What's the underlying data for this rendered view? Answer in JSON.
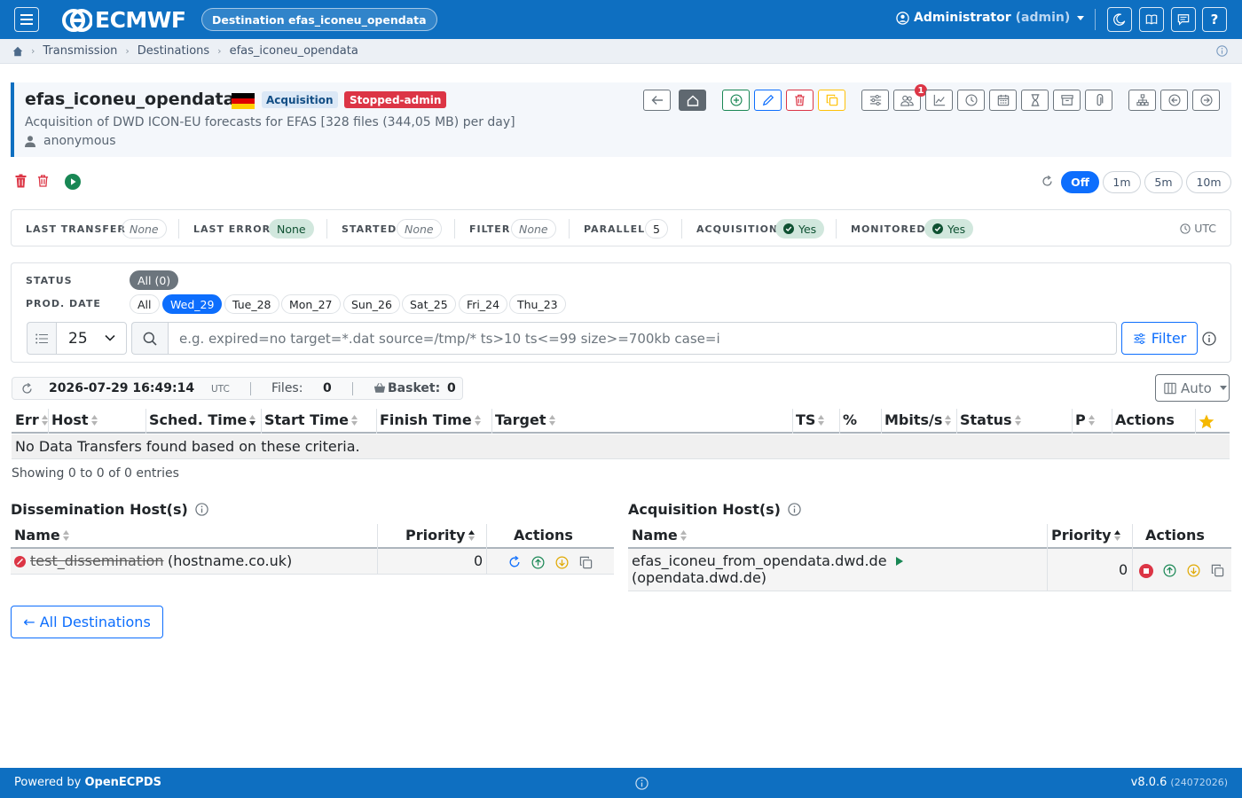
{
  "topbar": {
    "brand": "ECMWF",
    "destination_pill": "Destination efas_iconeu_opendata",
    "user_name": "Administrator",
    "user_role": "(admin)",
    "icons": [
      "menu-icon",
      "moon-icon",
      "book-icon",
      "chat-icon",
      "help-icon"
    ],
    "help_glyph": "?"
  },
  "breadcrumb": {
    "items": [
      "Transmission",
      "Destinations",
      "efas_iconeu_opendata"
    ]
  },
  "destination": {
    "name": "efas_iconeu_opendata",
    "type_badge": "Acquisition",
    "status_badge": "Stopped-admin",
    "description": "Acquisition of DWD ICON-EU forecasts for EFAS [328 files (344,05 MB) per day]",
    "owner": "anonymous",
    "flag_colors": [
      "#000000",
      "#dd0000",
      "#ffce00"
    ],
    "notification_count": "1"
  },
  "refresh": {
    "options": [
      "Off",
      "1m",
      "5m",
      "10m"
    ],
    "selected": "Off"
  },
  "info": {
    "last_transfer_label": "LAST TRANSFER",
    "last_transfer_value": "None",
    "last_error_label": "LAST ERROR",
    "last_error_value": "None",
    "started_label": "STARTED",
    "started_value": "None",
    "filter_label": "FILTER",
    "filter_value": "None",
    "parallel_label": "PARALLEL",
    "parallel_value": "5",
    "acquisition_label": "ACQUISITION",
    "acquisition_value": "Yes",
    "monitored_label": "MONITORED",
    "monitored_value": "Yes",
    "timezone": "UTC"
  },
  "filters": {
    "status_label": "STATUS",
    "status_all": "All (0)",
    "prod_date_label": "PROD. DATE",
    "dates": [
      "All",
      "Wed_29",
      "Tue_28",
      "Mon_27",
      "Sun_26",
      "Sat_25",
      "Fri_24",
      "Thu_23"
    ],
    "selected_date": "Wed_29",
    "page_length": "25",
    "search_placeholder": "e.g. expired=no target=*.dat source=/tmp/* ts>10 ts<=99 size>=700kb case=i",
    "filter_button": "Filter"
  },
  "stats": {
    "timestamp": "2026-07-29 16:49:14",
    "tz": "UTC",
    "files_label": "Files:",
    "files_value": "0",
    "basket_label": "Basket:",
    "basket_value": "0",
    "columns_button": "Auto"
  },
  "transfers_table": {
    "columns": [
      "Err",
      "Host",
      "Sched. Time",
      "Start Time",
      "Finish Time",
      "Target",
      "TS",
      "%",
      "Mbits/s",
      "Status",
      "P",
      "Actions"
    ],
    "empty_message": "No Data Transfers found based on these criteria.",
    "showing": "Showing 0 to 0 of 0 entries"
  },
  "dissemination": {
    "title": "Dissemination Host(s)",
    "columns": [
      "Name",
      "Priority",
      "Actions"
    ],
    "rows": [
      {
        "name": "test_dissemination",
        "hostname": "(hostname.co.uk)",
        "priority": "0"
      }
    ]
  },
  "acquisition": {
    "title": "Acquisition Host(s)",
    "columns": [
      "Name",
      "Priority",
      "Actions"
    ],
    "rows": [
      {
        "name": "efas_iconeu_from_opendata.dwd.de",
        "hostname": "(opendata.dwd.de)",
        "priority": "0"
      }
    ]
  },
  "back_button": "← All Destinations",
  "footer": {
    "powered_by": "Powered by",
    "product": "OpenECPDS",
    "version": "v8.0.6",
    "build": "(24072026)"
  }
}
